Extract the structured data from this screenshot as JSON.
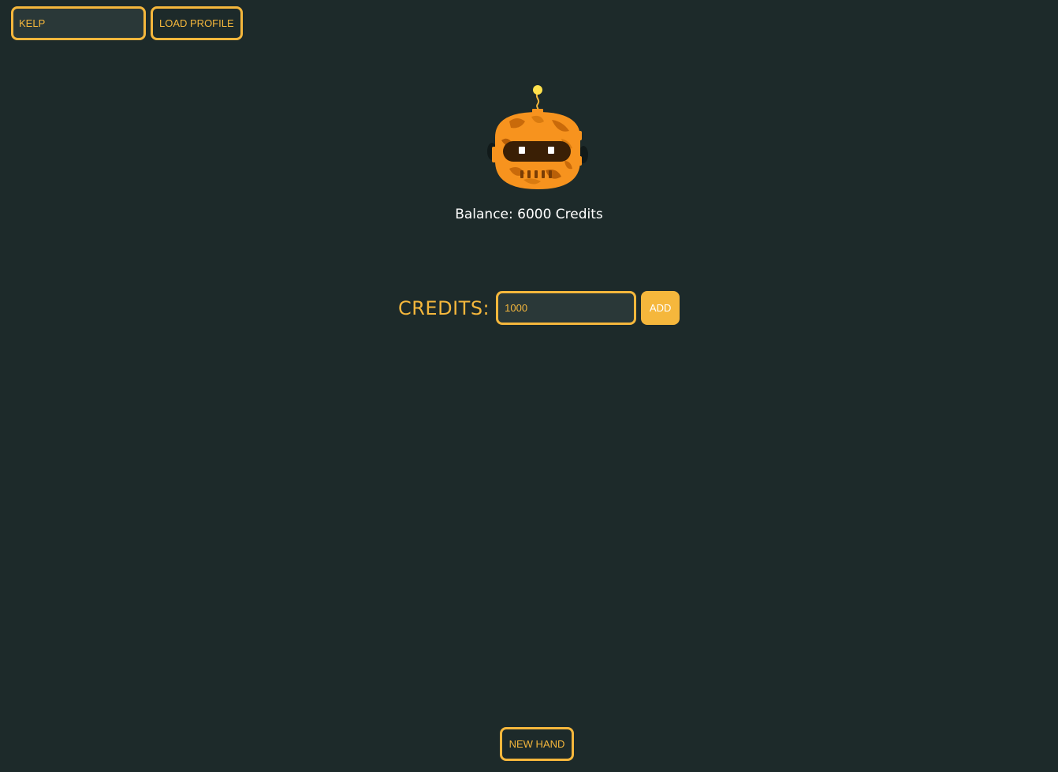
{
  "profile": {
    "name_value": "KELP",
    "load_label": "LOAD PROFILE"
  },
  "avatar": {
    "icon": "robot-avatar-icon",
    "primary_color": "#f7931e",
    "dark_color": "#3a1f05",
    "antenna_color": "#ffe14d"
  },
  "balance": {
    "text": "Balance: 6000 Credits"
  },
  "credits": {
    "label": "CREDITS:",
    "value": "1000",
    "add_label": "ADD"
  },
  "footer": {
    "new_hand_label": "NEW HAND"
  },
  "colors": {
    "background": "#1d2a2a",
    "accent": "#f5b73c",
    "input_bg": "#2a3838"
  }
}
